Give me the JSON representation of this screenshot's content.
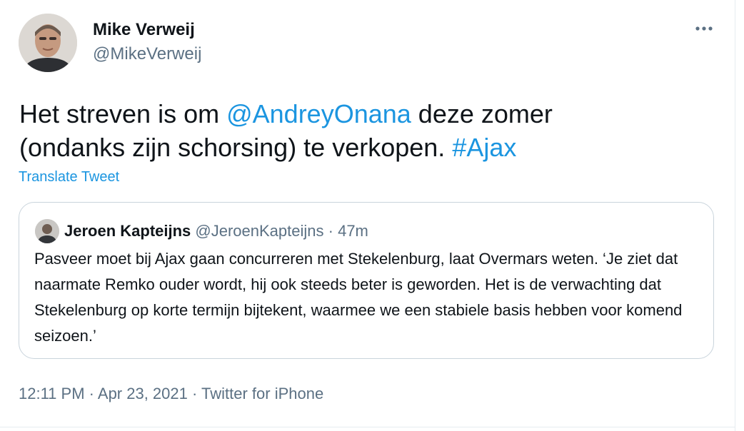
{
  "author": {
    "name": "Mike Verweij",
    "handle": "@MikeVerweij",
    "avatar_icon": "person-photo-avatar"
  },
  "menu": {
    "more_icon": "more-horizontal-icon",
    "more_glyph": "•••"
  },
  "tweet": {
    "text_part1": "Het streven is om ",
    "mention": "@AndreyOnana",
    "text_part2": " deze zomer (ondanks zijn schorsing) te verkopen. ",
    "hashtag": "#Ajax",
    "translate_label": "Translate Tweet"
  },
  "quote": {
    "name": "Jeroen Kapteijns",
    "handle": "@JeroenKapteijns",
    "separator": " · ",
    "time": "47m",
    "avatar_icon": "person-photo-avatar",
    "text": "Pasveer moet bij Ajax gaan concurreren met Stekelenburg, laat Overmars weten. ‘Je ziet dat naarmate Remko ouder wordt, hij ook steeds beter is geworden. Het is de verwachting dat Stekelenburg op korte termijn bijtekent, waarmee we een stabiele basis hebben voor komend seizoen.’"
  },
  "meta": {
    "time": "12:11 PM",
    "separator": " · ",
    "date": "Apr 23, 2021",
    "source": "Twitter for iPhone"
  },
  "colors": {
    "link": "#1b95e0",
    "secondary_text": "#5b7083",
    "primary_text": "#0f1419",
    "border": "#c9d4dc"
  }
}
